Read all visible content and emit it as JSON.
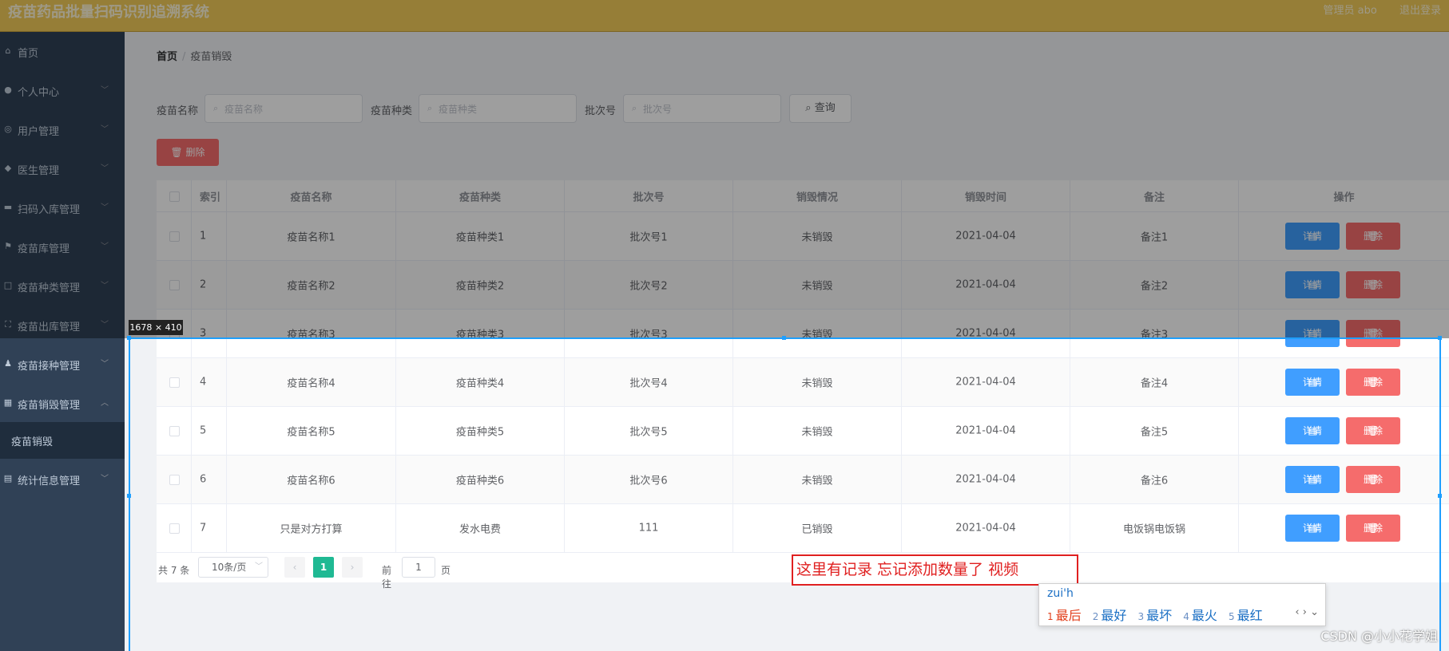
{
  "header": {
    "title": "疫苗药品批量扫码识别追溯系统",
    "user_label": "管理员 abo",
    "logout": "退出登录"
  },
  "sidebar": {
    "items": [
      {
        "label": "首页",
        "icon": "home-icon"
      },
      {
        "label": "个人中心",
        "icon": "user-icon"
      },
      {
        "label": "用户管理",
        "icon": "users-icon"
      },
      {
        "label": "医生管理",
        "icon": "location-icon"
      },
      {
        "label": "扫码入库管理",
        "icon": "chat-icon"
      },
      {
        "label": "疫苗库管理",
        "icon": "flag-icon"
      },
      {
        "label": "疫苗种类管理",
        "icon": "tag-icon"
      },
      {
        "label": "疫苗出库管理",
        "icon": "fullscreen-icon"
      },
      {
        "label": "疫苗接种管理",
        "icon": "person-icon"
      },
      {
        "label": "疫苗销毁管理",
        "icon": "grid-icon"
      },
      {
        "label": "统计信息管理",
        "icon": "document-icon"
      }
    ],
    "submenu": "疫苗销毁"
  },
  "breadcrumb": {
    "home": "首页",
    "current": "疫苗销毁"
  },
  "search": {
    "name_label": "疫苗名称",
    "name_placeholder": "疫苗名称",
    "type_label": "疫苗种类",
    "type_placeholder": "疫苗种类",
    "batch_label": "批次号",
    "batch_placeholder": "批次号",
    "query_button": "查询"
  },
  "delete_button": "删除",
  "table": {
    "columns": [
      "索引",
      "疫苗名称",
      "疫苗种类",
      "批次号",
      "销毁情况",
      "销毁时间",
      "备注",
      "操作"
    ],
    "rows": [
      {
        "idx": "1",
        "name": "疫苗名称1",
        "type": "疫苗种类1",
        "batch": "批次号1",
        "status": "未销毁",
        "time": "2021-04-04",
        "note": "备注1"
      },
      {
        "idx": "2",
        "name": "疫苗名称2",
        "type": "疫苗种类2",
        "batch": "批次号2",
        "status": "未销毁",
        "time": "2021-04-04",
        "note": "备注2"
      },
      {
        "idx": "3",
        "name": "疫苗名称3",
        "type": "疫苗种类3",
        "batch": "批次号3",
        "status": "未销毁",
        "time": "2021-04-04",
        "note": "备注3"
      },
      {
        "idx": "4",
        "name": "疫苗名称4",
        "type": "疫苗种类4",
        "batch": "批次号4",
        "status": "未销毁",
        "time": "2021-04-04",
        "note": "备注4"
      },
      {
        "idx": "5",
        "name": "疫苗名称5",
        "type": "疫苗种类5",
        "batch": "批次号5",
        "status": "未销毁",
        "time": "2021-04-04",
        "note": "备注5"
      },
      {
        "idx": "6",
        "name": "疫苗名称6",
        "type": "疫苗种类6",
        "batch": "批次号6",
        "status": "未销毁",
        "time": "2021-04-04",
        "note": "备注6"
      },
      {
        "idx": "7",
        "name": "只是对方打算",
        "type": "发水电费",
        "batch": "111",
        "status": "已销毁",
        "time": "2021-04-04",
        "note": "电饭锅电饭锅"
      }
    ],
    "detail_label": "详情",
    "delete_label": "删除"
  },
  "pagination": {
    "total": "共 7 条",
    "page_size": "10条/页",
    "current": "1",
    "goto": "前往",
    "goto_value": "1",
    "page_suffix": "页"
  },
  "screenshot_tool": {
    "dimensions": "1678 × 410"
  },
  "annotation": "这里有记录 忘记添加数量了 视频",
  "ime": {
    "composition": "zui'h",
    "candidates": [
      {
        "n": "1",
        "text": "最后"
      },
      {
        "n": "2",
        "text": "最好"
      },
      {
        "n": "3",
        "text": "最坏"
      },
      {
        "n": "4",
        "text": "最火"
      },
      {
        "n": "5",
        "text": "最红"
      }
    ]
  },
  "watermark": "CSDN @小小花学姐",
  "colors": {
    "header": "#f3cc5a",
    "sidebar": "#304156",
    "primary": "#409eff",
    "danger": "#f56c6c",
    "pager_active": "#1fb993",
    "annotation": "#e02020"
  }
}
